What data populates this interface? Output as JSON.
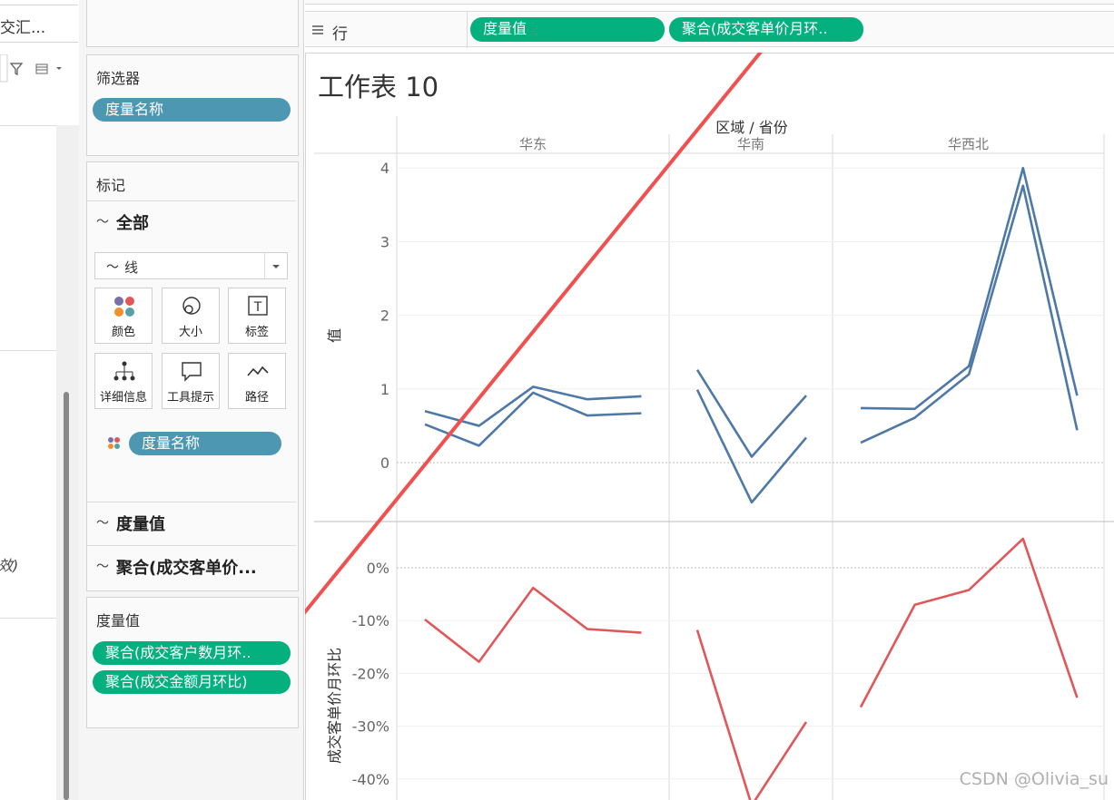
{
  "data_pane": {
    "title_partial": "交汇...",
    "bottom_partial": "效)"
  },
  "filters_card": {
    "title": "筛选器",
    "pill": "度量名称"
  },
  "marks_card": {
    "title": "标记",
    "all_label": "全部",
    "mark_type": "线",
    "buttons": [
      {
        "label": "颜色",
        "icon": "color-icon"
      },
      {
        "label": "大小",
        "icon": "size-icon"
      },
      {
        "label": "标签",
        "icon": "label-icon"
      },
      {
        "label": "详细信息",
        "icon": "detail-icon"
      },
      {
        "label": "工具提示",
        "icon": "tooltip-icon"
      },
      {
        "label": "路径",
        "icon": "path-icon"
      }
    ],
    "color_pill": "度量名称",
    "sections": [
      "度量值",
      "聚合(成交客单价..."
    ]
  },
  "measure_values_card": {
    "title": "度量值",
    "pills": [
      "聚合(成交客户数月环..",
      "聚合(成交金额月环比)"
    ]
  },
  "rows_shelf": {
    "label": "行",
    "pills": [
      "度量值",
      "聚合(成交客单价月环.."
    ]
  },
  "watermark": "CSDN @Olivia_su",
  "colors": {
    "blue_pill": "#4e97b3",
    "green_pill": "#04b07e",
    "line_blue": "#4e79a7",
    "line_red": "#e15759",
    "arrow": "#f05050"
  },
  "chart_data": {
    "type": "line",
    "title": "工作表 10",
    "column_header": "区域 / 省份",
    "panels": [
      "华东",
      "华南",
      "华西北"
    ],
    "top_axis": {
      "label": "值",
      "ticks": [
        "4",
        "3",
        "2",
        "1",
        "0"
      ],
      "ylim": [
        -0.8,
        4.2
      ]
    },
    "bottom_axis": {
      "label": "成交客单价月环比",
      "ticks": [
        "0%",
        "-10%",
        "-20%",
        "-30%",
        "-40%"
      ],
      "ylim": [
        -44,
        5
      ]
    },
    "series_top_a": [
      [
        0.7,
        0.5,
        1.03,
        0.86,
        0.9
      ],
      [
        1.26,
        0.08,
        0.91
      ],
      [
        0.74,
        0.73,
        1.31,
        4.0,
        0.91
      ]
    ],
    "series_top_b": [
      [
        0.52,
        0.23,
        0.95,
        0.64,
        0.67
      ],
      [
        0.99,
        -0.54,
        0.34
      ],
      [
        0.27,
        0.61,
        1.2,
        3.76,
        0.44
      ]
    ],
    "series_bottom": [
      [
        -9.8,
        -17.8,
        -3.8,
        -11.6,
        -12.3
      ],
      [
        -11.8,
        -45,
        -29.2
      ],
      [
        -26.4,
        -7.0,
        -4.2,
        5.5,
        -24.6
      ]
    ]
  }
}
